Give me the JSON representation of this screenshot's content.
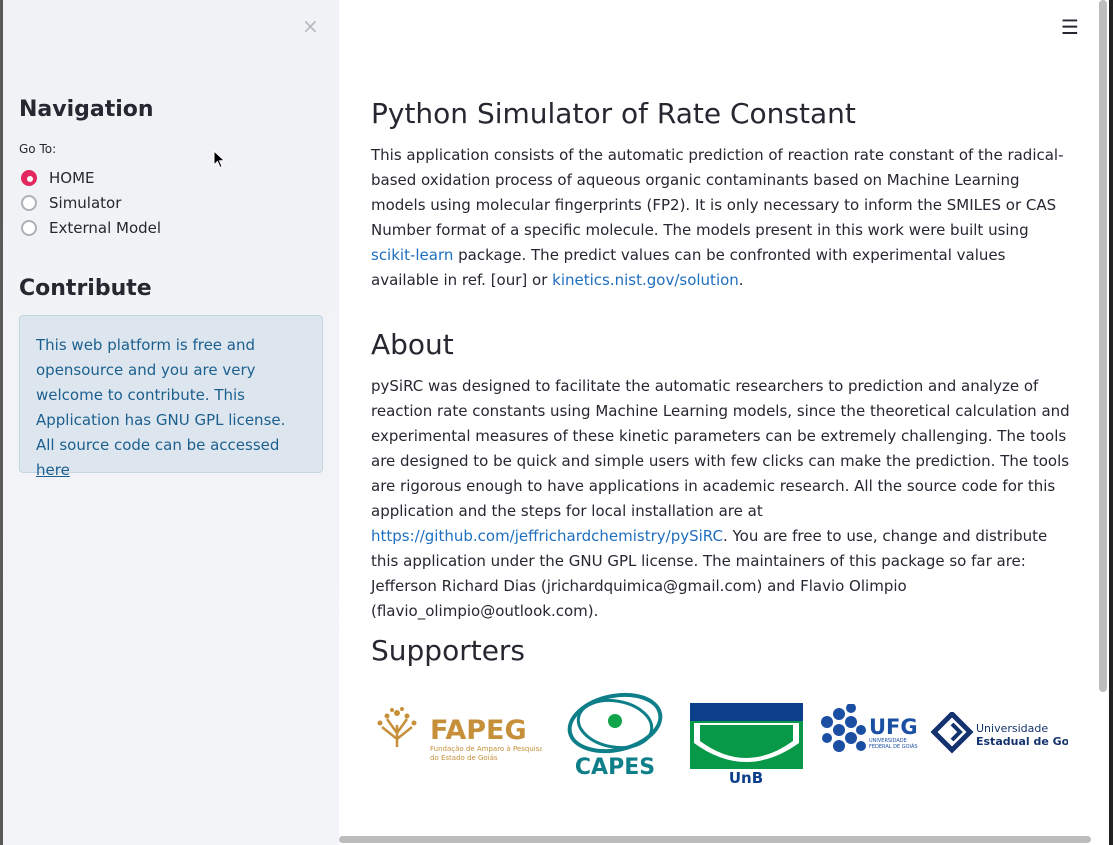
{
  "sidebar": {
    "close_icon": "×",
    "navigation_title": "Navigation",
    "goto_label": "Go To:",
    "options": [
      "HOME",
      "Simulator",
      "External Model"
    ],
    "selected": "HOME",
    "contribute_title": "Contribute",
    "contribute_text": "This web platform is free and opensource and you are very welcome to contribute. This Application has GNU GPL license. All source code can be accessed ",
    "contribute_link": "here"
  },
  "main": {
    "title": "Python Simulator of Rate Constant",
    "intro_1": "This application consists of the automatic prediction of reaction rate constant of the radical-based oxidation process of aqueous organic contaminants based on Machine Learning models using molecular fingerprints (FP2). It is only necessary to inform the SMILES or CAS Number format of a specific molecule. The models present in this work were built using ",
    "intro_link_1": "scikit-learn",
    "intro_2": " package. The predict values can be confronted with experimental values available in ref. [our] or ",
    "intro_link_2": "kinetics.nist.gov/solution",
    "intro_3": ".",
    "about_title": "About",
    "about_1": "pySiRC was designed to facilitate the automatic researchers to prediction and analyze of reaction rate constants using Machine Learning models, since the theoretical calculation and experimental measures of these kinetic parameters can be extremely challenging. The tools are designed to be quick and simple users with few clicks can make the prediction. The tools are rigorous enough to have applications in academic research. All the source code for this application and the steps for local installation are at ",
    "about_link": "https://github.com/jeffrichardchemistry/pySiRC",
    "about_2": ". You are free to use, change and distribute this application under the GNU GPL license. The maintainers of this package so far are: Jefferson Richard Dias (jrichardquimica@gmail.com) and Flavio Olimpio (flavio_olimpio@outlook.com).",
    "supporters_title": "Supporters",
    "menu_icon": "☰",
    "logos": {
      "fapeg": "FAPEG",
      "fapeg_sub1": "Fundação de Amparo à Pesquisa",
      "fapeg_sub2": "do Estado de Goiás",
      "capes": "CAPES",
      "unb": "UnB",
      "ufg": "UFG",
      "ufg_sub1": "UNIVERSIDADE",
      "ufg_sub2": "FEDERAL DE GOIÁS",
      "ueg_1": "Universidade",
      "ueg_2": "Estadual de Goiás"
    }
  }
}
